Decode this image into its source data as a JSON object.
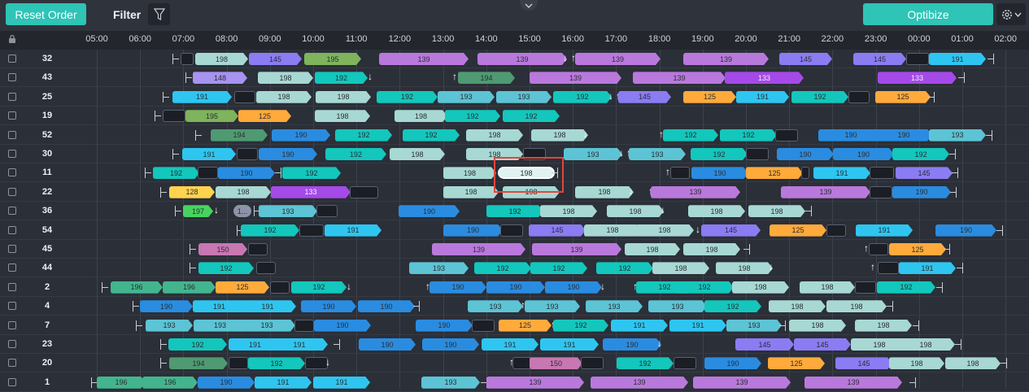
{
  "toolbar": {
    "reset_label": "Reset Order",
    "filter_label": "Filter",
    "optibize_label": "Optibize"
  },
  "colors": {
    "accent": "#2ec4b6",
    "background": "#2b2f38",
    "highlight": "#e0473c"
  },
  "icons": {
    "filter": "funnel-icon",
    "settings": "gear-icon",
    "collapse": "chevron-down-icon",
    "lock": "lock-icon"
  },
  "timeline": {
    "hours": [
      "05:00",
      "06:00",
      "07:00",
      "08:00",
      "09:00",
      "10:00",
      "11:00",
      "12:00",
      "13:00",
      "14:00",
      "15:00",
      "16:00",
      "17:00",
      "18:00",
      "19:00",
      "20:00",
      "21:00",
      "22:00",
      "23:00",
      "00:00",
      "01:00",
      "02:00"
    ]
  },
  "row_ids": [
    "32",
    "43",
    "25",
    "19",
    "52",
    "30",
    "11",
    "22",
    "36",
    "54",
    "45",
    "44",
    "2",
    "4",
    "7",
    "23",
    "20",
    "1"
  ],
  "trips": [
    [
      "198",
      "145",
      "195",
      "139",
      "139",
      "139",
      "139",
      "145",
      "145",
      "191"
    ],
    [
      "148",
      "198",
      "192",
      "194",
      "139",
      "139",
      "133",
      "133"
    ],
    [
      "191",
      "198",
      "198",
      "192",
      "193",
      "193",
      "192",
      "145",
      "125",
      "191",
      "192",
      "125"
    ],
    [
      "195",
      "125",
      "198",
      "198",
      "192",
      "192"
    ],
    [
      "194",
      "190",
      "192",
      "192",
      "198",
      "198",
      "192",
      "192",
      "190",
      "190",
      "193"
    ],
    [
      "191",
      "190",
      "192",
      "198",
      "198",
      "193",
      "193",
      "192",
      "190",
      "190",
      "192"
    ],
    [
      "192",
      "190",
      "192",
      "198",
      "198",
      "190",
      "125",
      "191",
      "145"
    ],
    [
      "128",
      "198",
      "133",
      "198",
      "198",
      "198",
      "139",
      "139",
      "190"
    ],
    [
      "197",
      "1...",
      "193",
      "190",
      "192",
      "198",
      "198",
      "198",
      "198"
    ],
    [
      "192",
      "191",
      "190",
      "145",
      "198",
      "198",
      "145",
      "125",
      "191",
      "190"
    ],
    [
      "150",
      "139",
      "139",
      "198",
      "198",
      "125"
    ],
    [
      "192",
      "193",
      "192",
      "192",
      "192",
      "198",
      "198",
      "191"
    ],
    [
      "196",
      "196",
      "125",
      "192",
      "190",
      "190",
      "190",
      "192",
      "192",
      "198",
      "198",
      "192"
    ],
    [
      "190",
      "191",
      "191",
      "190",
      "190",
      "193",
      "193",
      "193",
      "193",
      "192",
      "198",
      "198"
    ],
    [
      "193",
      "193",
      "193",
      "190",
      "190",
      "125",
      "192",
      "191",
      "191",
      "193",
      "198",
      "198"
    ],
    [
      "192",
      "191",
      "191",
      "190",
      "190",
      "191",
      "191",
      "190",
      "145",
      "145",
      "198",
      "198"
    ],
    [
      "194",
      "192",
      "150",
      "192",
      "190",
      "125",
      "145",
      "198",
      "198"
    ],
    [
      "196",
      "196",
      "190",
      "191",
      "191",
      "193",
      "139",
      "139",
      "139",
      "139"
    ]
  ]
}
